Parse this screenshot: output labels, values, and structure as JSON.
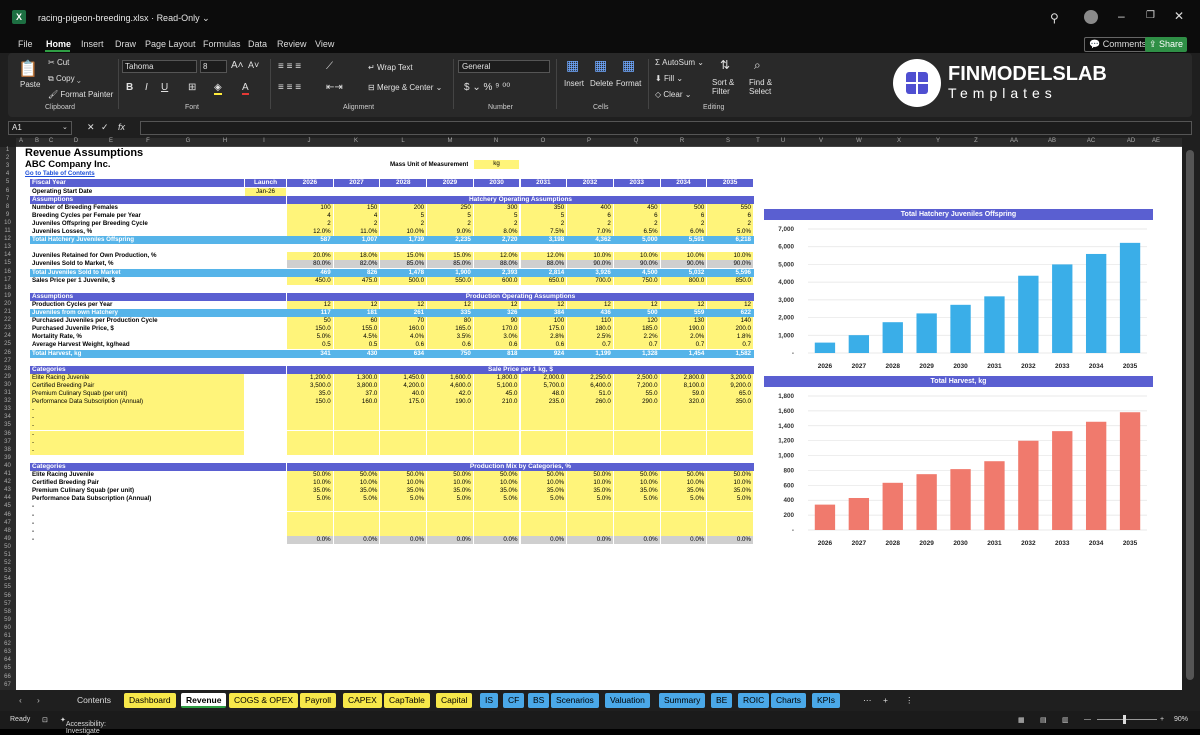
{
  "window": {
    "filename": "racing-pigeon-breeding.xlsx",
    "mode": "Read-Only"
  },
  "menu": [
    "File",
    "Home",
    "Insert",
    "Draw",
    "Page Layout",
    "Formulas",
    "Data",
    "Review",
    "View"
  ],
  "menu_right": {
    "comments": "Comments",
    "share": "Share"
  },
  "ribbon": {
    "paste": "Paste",
    "cut": "Cut",
    "copy": "Copy",
    "format_painter": "Format Painter",
    "clipboard": "Clipboard",
    "font_name": "Tahoma",
    "font_size": "8",
    "font": "Font",
    "wrap_text": "Wrap Text",
    "merge_center": "Merge & Center",
    "alignment": "Alignment",
    "number_format": "General",
    "number": "Number",
    "insert": "Insert",
    "delete": "Delete",
    "format": "Format",
    "cells": "Cells",
    "autosum": "AutoSum",
    "fill": "Fill",
    "clear": "Clear",
    "sort_filter": "Sort &\nFilter",
    "find_select": "Find &\nSelect",
    "editing": "Editing",
    "brand_top": "FINMODELSLAB",
    "brand_bottom": "Templates"
  },
  "formula_bar": {
    "name_box": "A1",
    "fx": "fx"
  },
  "columns": [
    "A",
    "B",
    "C",
    "D",
    "E",
    "F",
    "G",
    "H",
    "I",
    "J",
    "K",
    "L",
    "M",
    "N",
    "O",
    "P",
    "Q",
    "R",
    "S",
    "T",
    "U",
    "V",
    "W",
    "X",
    "Y",
    "Z",
    "AA",
    "AB",
    "AC",
    "AD",
    "AE"
  ],
  "sheet": {
    "title": "Revenue Assumptions",
    "company": "ABC Company Inc.",
    "toc_link": "Go to Table of Contents",
    "mass_unit_label": "Mass Unit of Measurement",
    "mass_unit_value": "kg",
    "fiscal_year_label": "Fiscal Year",
    "launch_label": "Launch",
    "years": [
      "2026",
      "2027",
      "2028",
      "2029",
      "2030",
      "2031",
      "2032",
      "2033",
      "2034",
      "2035"
    ],
    "op_start_label": "Operating Start Date",
    "op_start_value": "Jan-26",
    "assumptions_label": "Assumptions",
    "hatchery_header": "Hatchery Operating Assumptions",
    "production_header": "Production Operating Assumptions",
    "categories_label": "Categories",
    "sale_price_header": "Sale Price per 1 kg, $",
    "mix_header": "Production Mix by Categories, %",
    "hatchery_rows": [
      {
        "label": "Number of Breeding Females",
        "style": "yel",
        "values": [
          "100",
          "150",
          "200",
          "250",
          "300",
          "350",
          "400",
          "450",
          "500",
          "550"
        ]
      },
      {
        "label": "Breeding Cycles per Female per Year",
        "style": "yel",
        "values": [
          "4",
          "4",
          "5",
          "5",
          "5",
          "5",
          "6",
          "6",
          "6",
          "6"
        ]
      },
      {
        "label": "Juveniles Offspring per Breeding Cycle",
        "style": "yel",
        "values": [
          "2",
          "2",
          "2",
          "2",
          "2",
          "2",
          "2",
          "2",
          "2",
          "2"
        ]
      },
      {
        "label": "Juveniles Losses, %",
        "style": "yel",
        "values": [
          "12.0%",
          "11.0%",
          "10.0%",
          "9.0%",
          "8.0%",
          "7.5%",
          "7.0%",
          "6.5%",
          "6.0%",
          "5.0%"
        ]
      },
      {
        "label": "Total Hatchery Juveniles Offspring",
        "style": "blu",
        "values": [
          "587",
          "1,007",
          "1,739",
          "2,235",
          "2,720",
          "3,198",
          "4,362",
          "5,000",
          "5,591",
          "6,218"
        ]
      }
    ],
    "retained_rows": [
      {
        "label": "Juveniles Retained for Own Production, %",
        "style": "yel",
        "values": [
          "20.0%",
          "18.0%",
          "15.0%",
          "15.0%",
          "12.0%",
          "12.0%",
          "10.0%",
          "10.0%",
          "10.0%",
          "10.0%"
        ]
      },
      {
        "label": "Juveniles Sold to Market, %",
        "style": "gry",
        "values": [
          "80.0%",
          "82.0%",
          "85.0%",
          "85.0%",
          "88.0%",
          "88.0%",
          "90.0%",
          "90.0%",
          "90.0%",
          "90.0%"
        ]
      },
      {
        "label": "Total Juveniles Sold to Market",
        "style": "blu",
        "values": [
          "469",
          "826",
          "1,478",
          "1,900",
          "2,393",
          "2,814",
          "3,926",
          "4,500",
          "5,032",
          "5,596"
        ]
      },
      {
        "label": "Sales Price per 1 Juvenile, $",
        "style": "yel",
        "values": [
          "450.0",
          "475.0",
          "500.0",
          "550.0",
          "600.0",
          "650.0",
          "700.0",
          "750.0",
          "800.0",
          "850.0"
        ]
      }
    ],
    "production_rows": [
      {
        "label": "Production Cycles per Year",
        "style": "yel",
        "values": [
          "12",
          "12",
          "12",
          "12",
          "12",
          "12",
          "12",
          "12",
          "12",
          "12"
        ]
      },
      {
        "label": "Juveniles from own Hatchery",
        "style": "blu",
        "values": [
          "117",
          "181",
          "261",
          "335",
          "326",
          "384",
          "436",
          "500",
          "559",
          "622"
        ]
      },
      {
        "label": "Purchased Juveniles per Production Cycle",
        "style": "yel",
        "values": [
          "50",
          "60",
          "70",
          "80",
          "90",
          "100",
          "110",
          "120",
          "130",
          "140"
        ]
      },
      {
        "label": "Purchased Juvenile Price, $",
        "style": "yel",
        "values": [
          "150.0",
          "155.0",
          "160.0",
          "165.0",
          "170.0",
          "175.0",
          "180.0",
          "185.0",
          "190.0",
          "200.0"
        ]
      },
      {
        "label": "Mortality Rate, %",
        "style": "yel",
        "values": [
          "5.0%",
          "4.5%",
          "4.0%",
          "3.5%",
          "3.0%",
          "2.8%",
          "2.5%",
          "2.2%",
          "2.0%",
          "1.8%"
        ]
      },
      {
        "label": "Average Harvest Weight, kg/head",
        "style": "yel",
        "values": [
          "0.5",
          "0.5",
          "0.6",
          "0.6",
          "0.6",
          "0.6",
          "0.7",
          "0.7",
          "0.7",
          "0.7"
        ]
      },
      {
        "label": "Total Harvest, kg",
        "style": "blu",
        "values": [
          "341",
          "430",
          "634",
          "750",
          "818",
          "924",
          "1,199",
          "1,328",
          "1,454",
          "1,582"
        ]
      }
    ],
    "price_rows": [
      {
        "label": "Elite Racing Juvenile",
        "values": [
          "1,200.0",
          "1,300.0",
          "1,450.0",
          "1,600.0",
          "1,800.0",
          "2,000.0",
          "2,250.0",
          "2,500.0",
          "2,800.0",
          "3,200.0"
        ]
      },
      {
        "label": "Certified Breeding Pair",
        "values": [
          "3,500.0",
          "3,800.0",
          "4,200.0",
          "4,600.0",
          "5,100.0",
          "5,700.0",
          "6,400.0",
          "7,200.0",
          "8,100.0",
          "9,200.0"
        ]
      },
      {
        "label": "Premium Culinary Squab (per unit)",
        "values": [
          "35.0",
          "37.0",
          "40.0",
          "42.0",
          "45.0",
          "48.0",
          "51.0",
          "55.0",
          "59.0",
          "65.0"
        ]
      },
      {
        "label": "Performance Data Subscription (Annual)",
        "values": [
          "150.0",
          "160.0",
          "175.0",
          "190.0",
          "210.0",
          "235.0",
          "260.0",
          "290.0",
          "320.0",
          "350.0"
        ]
      },
      {
        "label": "-",
        "values": [
          "",
          "",
          "",
          "",
          "",
          "",
          "",
          "",
          "",
          ""
        ]
      },
      {
        "label": "-",
        "values": [
          "",
          "",
          "",
          "",
          "",
          "",
          "",
          "",
          "",
          ""
        ]
      },
      {
        "label": "-",
        "values": [
          "",
          "",
          "",
          "",
          "",
          "",
          "",
          "",
          "",
          ""
        ]
      },
      {
        "label": "-",
        "values": [
          "",
          "",
          "",
          "",
          "",
          "",
          "",
          "",
          "",
          ""
        ]
      },
      {
        "label": "-",
        "values": [
          "",
          "",
          "",
          "",
          "",
          "",
          "",
          "",
          "",
          ""
        ]
      },
      {
        "label": "-",
        "values": [
          "",
          "",
          "",
          "",
          "",
          "",
          "",
          "",
          "",
          ""
        ]
      }
    ],
    "mix_rows": [
      {
        "label": "Elite Racing Juvenile",
        "values": [
          "50.0%",
          "50.0%",
          "50.0%",
          "50.0%",
          "50.0%",
          "50.0%",
          "50.0%",
          "50.0%",
          "50.0%",
          "50.0%"
        ]
      },
      {
        "label": "Certified Breeding Pair",
        "values": [
          "10.0%",
          "10.0%",
          "10.0%",
          "10.0%",
          "10.0%",
          "10.0%",
          "10.0%",
          "10.0%",
          "10.0%",
          "10.0%"
        ]
      },
      {
        "label": "Premium Culinary Squab (per unit)",
        "values": [
          "35.0%",
          "35.0%",
          "35.0%",
          "35.0%",
          "35.0%",
          "35.0%",
          "35.0%",
          "35.0%",
          "35.0%",
          "35.0%"
        ]
      },
      {
        "label": "Performance Data Subscription (Annual)",
        "values": [
          "5.0%",
          "5.0%",
          "5.0%",
          "5.0%",
          "5.0%",
          "5.0%",
          "5.0%",
          "5.0%",
          "5.0%",
          "5.0%"
        ]
      },
      {
        "label": "-",
        "values": [
          "",
          "",
          "",
          "",
          "",
          "",
          "",
          "",
          "",
          ""
        ]
      },
      {
        "label": "-",
        "values": [
          "",
          "",
          "",
          "",
          "",
          "",
          "",
          "",
          "",
          ""
        ]
      },
      {
        "label": "-",
        "values": [
          "",
          "",
          "",
          "",
          "",
          "",
          "",
          "",
          "",
          ""
        ]
      },
      {
        "label": "-",
        "values": [
          "",
          "",
          "",
          "",
          "",
          "",
          "",
          "",
          "",
          ""
        ]
      },
      {
        "label": "-",
        "values": [
          "0.0%",
          "0.0%",
          "0.0%",
          "0.0%",
          "0.0%",
          "0.0%",
          "0.0%",
          "0.0%",
          "0.0%",
          "0.0%"
        ]
      }
    ]
  },
  "chart_data": [
    {
      "type": "bar",
      "title": "Total Hatchery Juveniles Offspring",
      "categories": [
        "2026",
        "2027",
        "2028",
        "2029",
        "2030",
        "2031",
        "2032",
        "2033",
        "2034",
        "2035"
      ],
      "values": [
        587,
        1007,
        1739,
        2235,
        2720,
        3198,
        4362,
        5000,
        5591,
        6218
      ],
      "ylim": [
        0,
        7000
      ],
      "yticks": [
        "7,000",
        "6,000",
        "5,000",
        "4,000",
        "3,000",
        "2,000",
        "1,000",
        "-"
      ],
      "color": "#3aaee8",
      "grid": true
    },
    {
      "type": "bar",
      "title": "Total Harvest, kg",
      "categories": [
        "2026",
        "2027",
        "2028",
        "2029",
        "2030",
        "2031",
        "2032",
        "2033",
        "2034",
        "2035"
      ],
      "values": [
        341,
        430,
        634,
        750,
        818,
        924,
        1199,
        1328,
        1454,
        1582
      ],
      "ylim": [
        0,
        1800
      ],
      "yticks": [
        "1,800",
        "1,600",
        "1,400",
        "1,200",
        "1,000",
        "800",
        "600",
        "400",
        "200",
        "-"
      ],
      "color": "#f07a6d",
      "grid": true
    }
  ],
  "tabs": [
    {
      "label": "Contents",
      "color": "none"
    },
    {
      "label": "Dashboard",
      "color": "#f7e84a"
    },
    {
      "label": "Revenue",
      "color": "active"
    },
    {
      "label": "COGS & OPEX",
      "color": "#f7e84a"
    },
    {
      "label": "Payroll",
      "color": "#f7e84a"
    },
    {
      "label": "CAPEX",
      "color": "#f7e84a"
    },
    {
      "label": "CapTable",
      "color": "#f7e84a"
    },
    {
      "label": "Capital",
      "color": "#f7e84a"
    },
    {
      "label": "IS",
      "color": "#4aa8e8"
    },
    {
      "label": "CF",
      "color": "#4aa8e8"
    },
    {
      "label": "BS",
      "color": "#4aa8e8"
    },
    {
      "label": "Scenarios",
      "color": "#4aa8e8"
    },
    {
      "label": "Valuation",
      "color": "#4aa8e8"
    },
    {
      "label": "Summary",
      "color": "#4aa8e8"
    },
    {
      "label": "BE",
      "color": "#4aa8e8"
    },
    {
      "label": "ROIC",
      "color": "#4aa8e8"
    },
    {
      "label": "Charts",
      "color": "#4aa8e8"
    },
    {
      "label": "KPIs",
      "color": "#4aa8e8"
    }
  ],
  "status": {
    "ready": "Ready",
    "accessibility": "Accessibility: Investigate",
    "zoom": "90%"
  }
}
